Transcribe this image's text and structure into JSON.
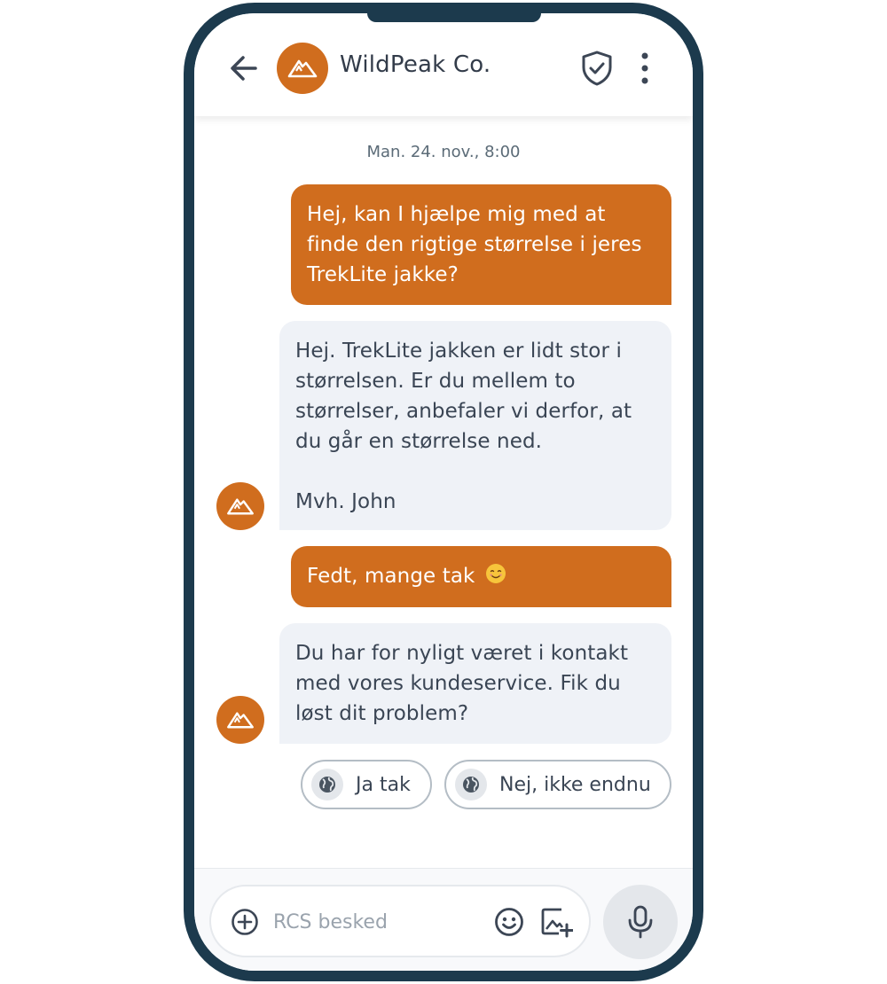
{
  "header": {
    "brand_name": "WildPeak Co.",
    "back_icon": "arrow-left-icon",
    "shield_icon": "verified-shield-icon",
    "more_icon": "more-vertical-icon"
  },
  "chat": {
    "date": "Man. 24. nov., 8:00",
    "messages": [
      {
        "direction": "outgoing",
        "text": "Hej, kan I hjælpe mig med at finde den rigtige størrelse i jeres TrekLite jakke?"
      },
      {
        "direction": "incoming",
        "text": "Hej. TrekLite jakken er lidt stor i størrelsen. Er du mellem to størrelser, anbefaler vi derfor, at du går en størrelse ned.",
        "signature": "Mvh. John"
      },
      {
        "direction": "outgoing",
        "text": "Fedt, mange tak",
        "emoji": "smiling-face-emoji"
      },
      {
        "direction": "incoming",
        "text": "Du har for nyligt været i kontakt med vores kundeservice. Fik du løst dit problem?"
      }
    ],
    "suggestions": [
      {
        "label": "Ja tak",
        "icon": "globe-icon"
      },
      {
        "label": "Nej, ikke endnu",
        "icon": "globe-icon"
      }
    ]
  },
  "composer": {
    "placeholder": "RCS besked",
    "value": "",
    "add_icon": "plus-circle-icon",
    "emoji_icon": "emoji-icon",
    "image_icon": "add-image-icon",
    "mic_icon": "microphone-icon"
  },
  "colors": {
    "brand": "#d06d1e",
    "frame": "#1c3a4d",
    "incoming_bubble": "#eff2f7"
  }
}
